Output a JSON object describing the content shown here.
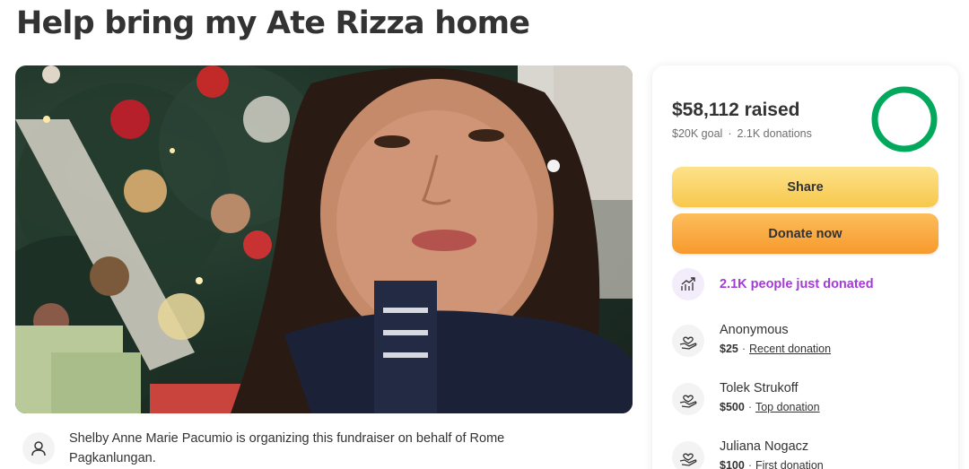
{
  "page": {
    "title": "Help bring my Ate Rizza home"
  },
  "organizer": {
    "text": "Shelby Anne Marie Pacumio is organizing this fundraiser on behalf of Rome Pagkanlungan.",
    "icon": "person-icon"
  },
  "summary": {
    "raised_amount": "$58,112",
    "raised_suffix": "raised",
    "goal": "$20K goal",
    "separator": "·",
    "donations_count": "2.1K donations",
    "progress_fraction": 1.0,
    "progress_color": "#02a95c"
  },
  "actions": {
    "share_label": "Share",
    "donate_label": "Donate now"
  },
  "activity": {
    "trend_text": "2.1K people just donated",
    "trend_color": "#a23bd6",
    "trend_icon": "trending-up-icon"
  },
  "donations": [
    {
      "name": "Anonymous",
      "amount": "$25",
      "separator": "·",
      "tag": "Recent donation",
      "icon": "heart-hand-icon"
    },
    {
      "name": "Tolek Strukoff",
      "amount": "$500",
      "separator": "·",
      "tag": "Top donation",
      "icon": "heart-hand-icon"
    },
    {
      "name": "Juliana Nogacz",
      "amount": "$100",
      "separator": "·",
      "tag": "First donation",
      "icon": "heart-hand-icon"
    }
  ]
}
